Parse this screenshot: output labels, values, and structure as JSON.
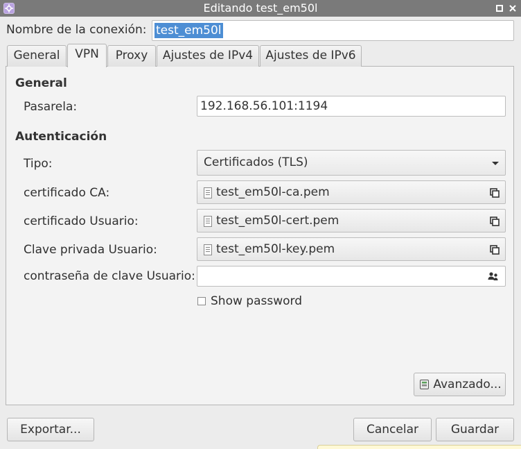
{
  "window": {
    "title": "Editando test_em50l"
  },
  "connection": {
    "name_label": "Nombre de la conexión:",
    "name_value": "test_em50l"
  },
  "tabs": [
    {
      "label": "General"
    },
    {
      "label": "VPN",
      "active": true
    },
    {
      "label": "Proxy"
    },
    {
      "label": "Ajustes de IPv4"
    },
    {
      "label": "Ajustes de IPv6"
    }
  ],
  "vpn": {
    "general_heading": "General",
    "gateway_label": "Pasarela:",
    "gateway_value": "192.168.56.101:1194",
    "auth_heading": "Autenticación",
    "type_label": "Tipo:",
    "type_value": "Certificados (TLS)",
    "ca_label": "certificado CA:",
    "ca_file": "test_em50l-ca.pem",
    "user_cert_label": "certificado Usuario:",
    "user_cert_file": "test_em50l-cert.pem",
    "key_label": "Clave privada Usuario:",
    "key_file": "test_em50l-key.pem",
    "key_password_label": "contraseña de clave Usuario:",
    "key_password_value": "",
    "show_password_label": "Show password",
    "show_password_checked": false,
    "advanced_label": "Avanzado..."
  },
  "footer": {
    "export_label": "Exportar...",
    "cancel_label": "Cancelar",
    "save_label": "Guardar"
  },
  "icons": {
    "app": "network-icon",
    "restore": "restore-icon",
    "close": "close-icon",
    "file": "document-icon",
    "browse": "copy-icon",
    "password_storage": "people-icon",
    "advanced": "advanced-icon"
  },
  "colors": {
    "titlebar": "#7a7a7a",
    "selection": "#4d8ed4",
    "panel": "#f3f3f3"
  }
}
